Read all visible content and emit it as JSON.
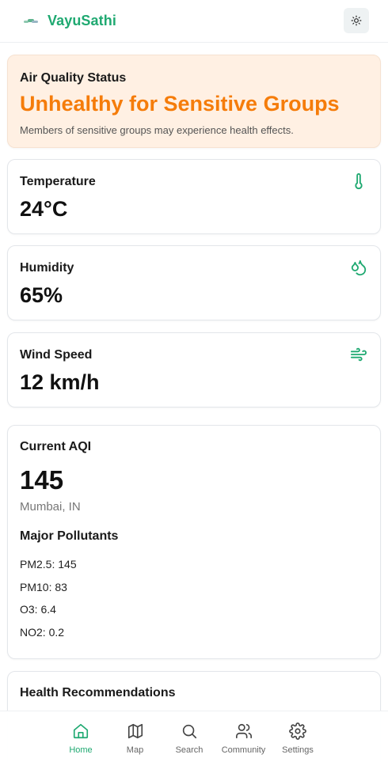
{
  "header": {
    "brand": "VayuSathi"
  },
  "status": {
    "label": "Air Quality Status",
    "value": "Unhealthy for Sensitive Groups",
    "description": "Members of sensitive groups may experience health effects.",
    "color": "#f57c0a"
  },
  "metrics": [
    {
      "label": "Temperature",
      "value": "24°C",
      "icon": "thermometer-icon"
    },
    {
      "label": "Humidity",
      "value": "65%",
      "icon": "droplets-icon"
    },
    {
      "label": "Wind Speed",
      "value": "12 km/h",
      "icon": "wind-icon"
    }
  ],
  "aqi": {
    "title": "Current AQI",
    "value": "145",
    "location": "Mumbai, IN",
    "pollutants_title": "Major Pollutants",
    "pollutants": [
      "PM2.5: 145",
      "PM10: 83",
      "O3: 6.4",
      "NO2: 0.2"
    ]
  },
  "health": {
    "title": "Health Recommendations"
  },
  "nav": {
    "items": [
      {
        "label": "Home",
        "icon": "home-icon",
        "active": true
      },
      {
        "label": "Map",
        "icon": "map-icon",
        "active": false
      },
      {
        "label": "Search",
        "icon": "search-icon",
        "active": false
      },
      {
        "label": "Community",
        "icon": "users-icon",
        "active": false
      },
      {
        "label": "Settings",
        "icon": "gear-icon",
        "active": false
      }
    ]
  },
  "colors": {
    "accent": "#1fa971",
    "status_bg": "#fff0e3",
    "status_text": "#f57c0a"
  }
}
